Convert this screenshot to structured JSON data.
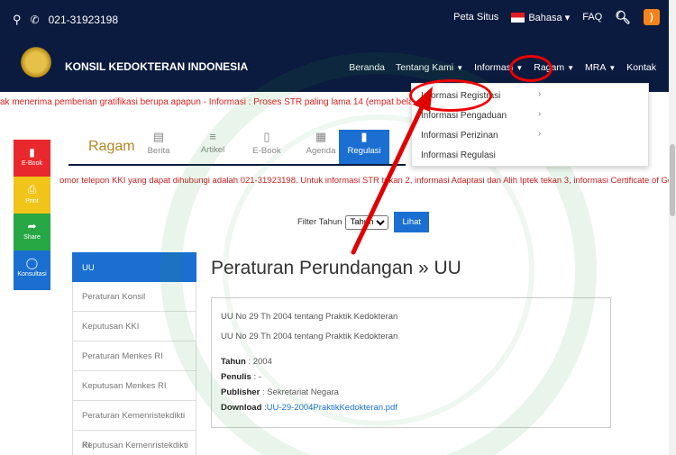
{
  "topbar": {
    "phone": "021-31923198",
    "links": [
      "Peta Situs",
      "Bahasa",
      "FAQ"
    ]
  },
  "header": {
    "brand": "KONSIL KEDOKTERAN INDONESIA",
    "nav": [
      "Beranda",
      "Tentang Kami",
      "Informasi",
      "Ragam",
      "MRA",
      "Kontak"
    ]
  },
  "ticker": "ak menerima pemberian gratifikasi berupa apapun - Informasi : Proses STR paling lama 14 (empat belas ) hari kerja sejak berkas dis",
  "dropdown": {
    "items": [
      "Informasi Registrasi",
      "Informasi Pengaduan",
      "Informasi Perizinan",
      "Informasi Regulasi"
    ]
  },
  "floating": [
    {
      "label": "E-Book",
      "color": "#e8282c"
    },
    {
      "label": "Print",
      "color": "#f0c419"
    },
    {
      "label": "Share",
      "color": "#28a745"
    },
    {
      "label": "Konsultasi",
      "color": "#1a6fd1"
    }
  ],
  "tabs": {
    "title": "Ragam",
    "items": [
      "Berita",
      "Artikel",
      "E-Book",
      "Agenda",
      "Regulasi"
    ]
  },
  "info_line": "omor telepon KKI yang dapat dihubungi adalah 021-31923198. Untuk informasi STR tekan 2, informasi Adaptasi dan Alih Iptek tekan 3, informasi Certificate of Good Standing (CoG",
  "filter": {
    "label": "Filter Tahun",
    "select_value": "Tahun",
    "button": "Lihat"
  },
  "sidelist": [
    "UU",
    "Peraturan Konsil",
    "Keputusan KKI",
    "Peraturan Menkes RI",
    "Keputusan Menkes RI",
    "Peraturan Kemenristekdikti RI",
    "Keputusan Kemenristekdikti RI"
  ],
  "page_title": "Peraturan Perundangan » UU",
  "card": {
    "title1": "UU No 29 Th 2004 tentang Praktik Kedokteran",
    "title2": "UU No 29 Th 2004 tentang Praktik Kedokteran",
    "tahun_label": "Tahun",
    "tahun": ": 2004",
    "penulis_label": "Penulis",
    "penulis": ": -",
    "publisher_label": "Publisher",
    "publisher": ": Sekretariat Negara",
    "download_label": "Download",
    "download": ":UU-29-2004PraktikKedokteran.pdf"
  },
  "colors": {
    "navy": "#0b1b3f",
    "accent": "#1a6fd1",
    "annotation": "#e00000"
  }
}
